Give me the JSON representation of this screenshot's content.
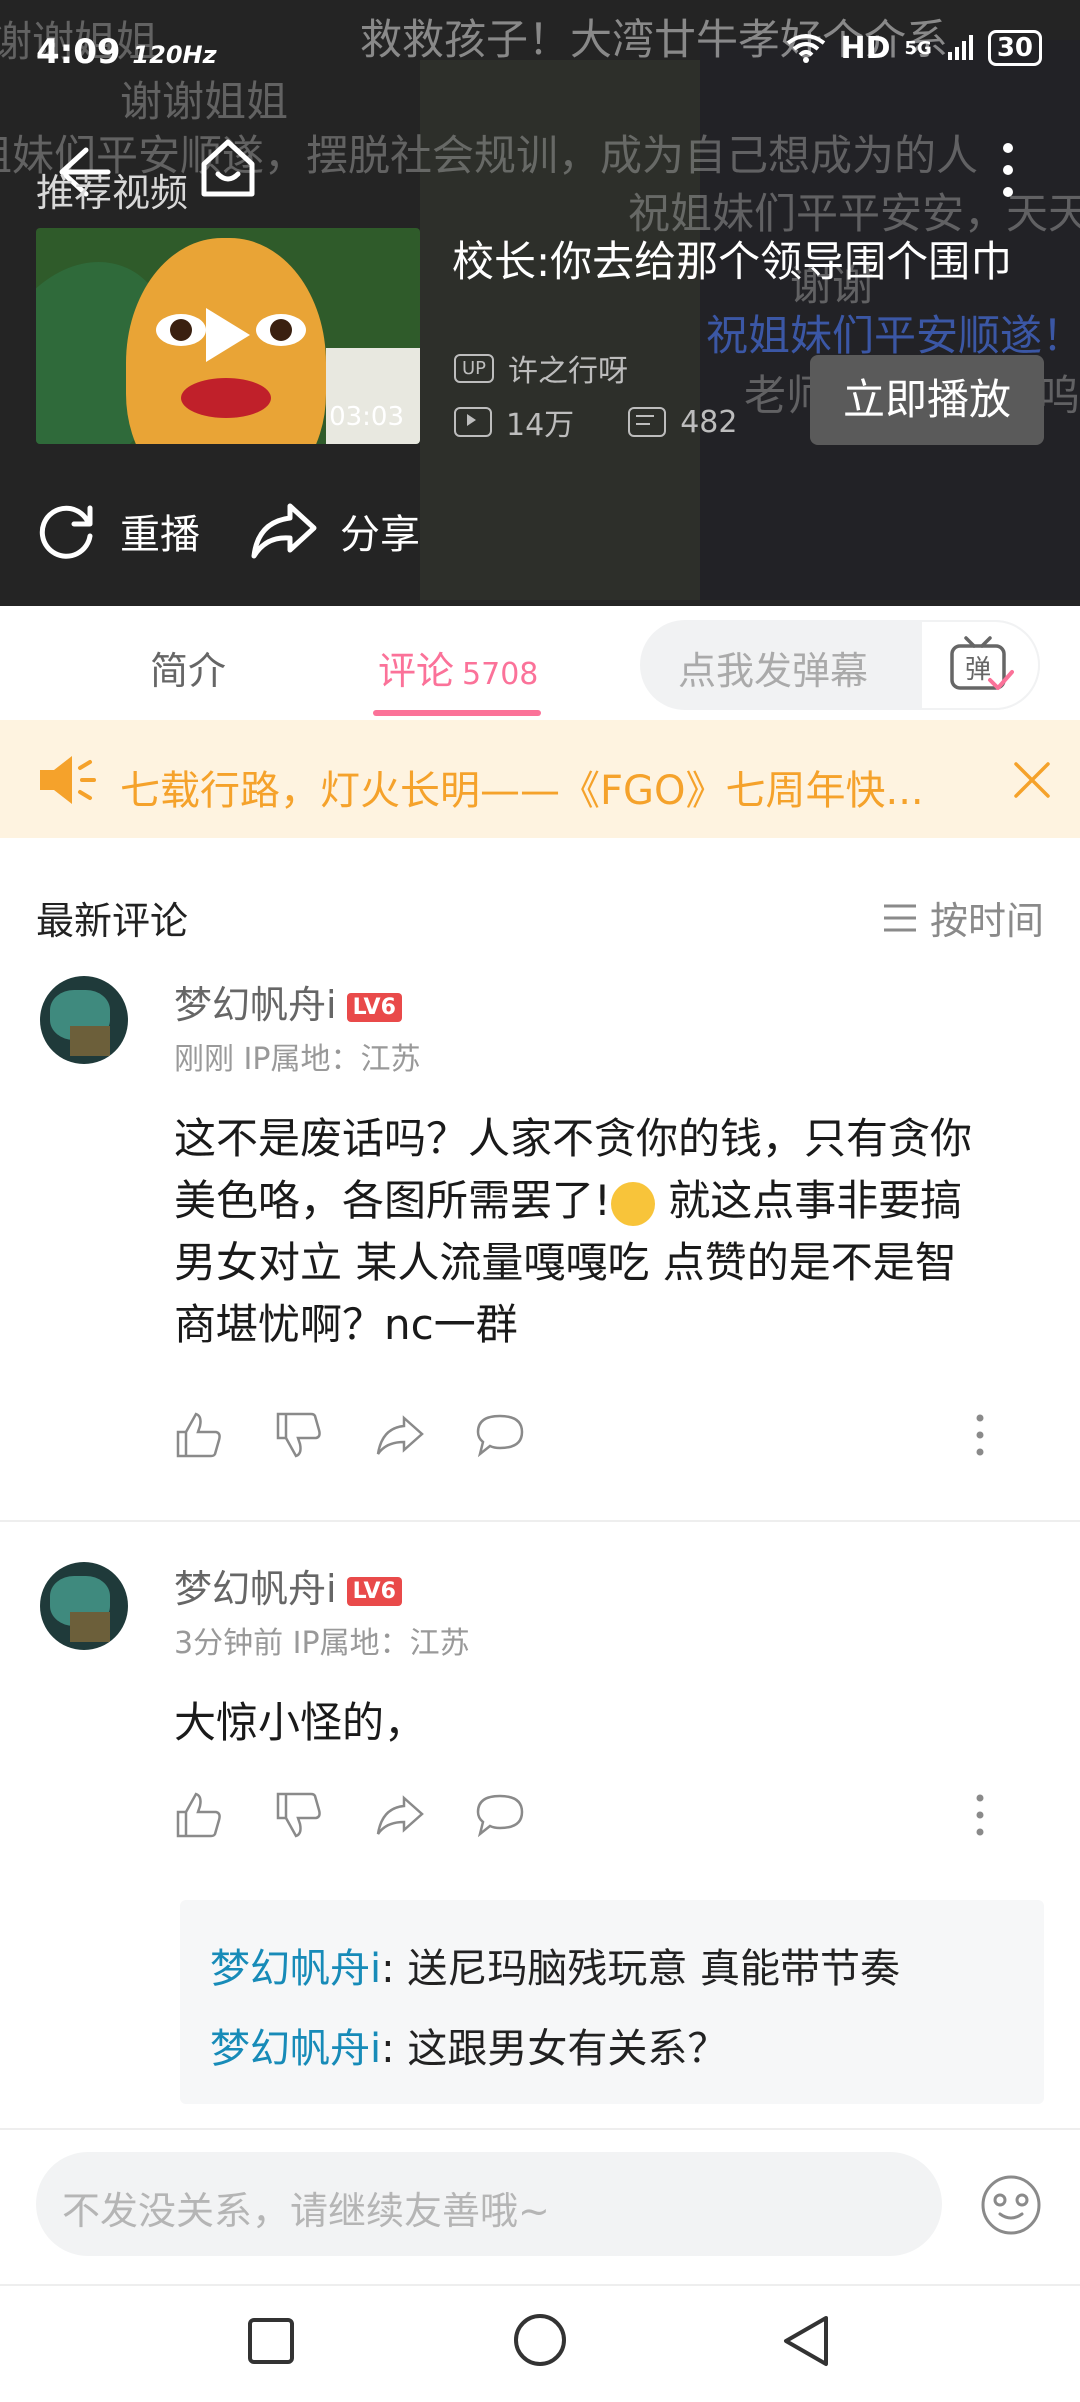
{
  "status_bar": {
    "time": "4:09",
    "refresh": "120Hz",
    "network": "HD",
    "signal": "5G",
    "battery": "30"
  },
  "danmaku": {
    "line1": "谢谢姐姐",
    "line2": "姐妹们平安顺遂，摆脱社会规训，成为自己想成为的人",
    "line3": "祝姐妹们平平安安，天天",
    "line4": "祝姐妹们平安顺遂！",
    "line5": "老师天下第一呜呜",
    "line6": "谢谢",
    "line7": "救救孩子！大湾廿牛孝好个介系",
    "line8": "谢谢姐姐"
  },
  "video": {
    "recommend_label": "推荐视频",
    "recommended_title": "校长:你去给那个领导围个围巾",
    "duration": "03:03",
    "up_badge": "UP",
    "uploader": "许之行呀",
    "views": "14万",
    "danmaku_count": "482",
    "play_now": "立即播放",
    "replay": "重播",
    "share": "分享"
  },
  "tabs": {
    "intro": "简介",
    "comments": "评论",
    "comment_count": "5708",
    "danmu_placeholder": "点我发弹幕",
    "danmu_button": "弹"
  },
  "banner": {
    "text": "七载行路，灯火长明——《FGO》七周年快..."
  },
  "comments_header": {
    "title": "最新评论",
    "sort": "按时间"
  },
  "comments": [
    {
      "user": "梦幻帆舟i",
      "level": "LV6",
      "time": "刚刚",
      "ip": "IP属地：江苏",
      "line1": "这不是废话吗？人家不贪你的钱，只有贪你",
      "line2a": "美色咯，各图所需罢了!",
      "line2b": " 就这点事非要搞",
      "line3": "男女对立 某人流量嘎嘎吃 点赞的是不是智",
      "line4": "商堪忧啊？nc一群"
    },
    {
      "user": "梦幻帆舟i",
      "level": "LV6",
      "time": "3分钟前",
      "ip": "IP属地：江苏",
      "text": "大惊小怪的，",
      "replies": [
        {
          "name": "梦幻帆舟i",
          "text": ": 送尼玛脑残玩意 真能带节奏"
        },
        {
          "name": "梦幻帆舟i",
          "text": ": 这跟男女有关系？"
        }
      ]
    }
  ],
  "input": {
    "placeholder": "不发没关系，请继续友善哦~"
  }
}
